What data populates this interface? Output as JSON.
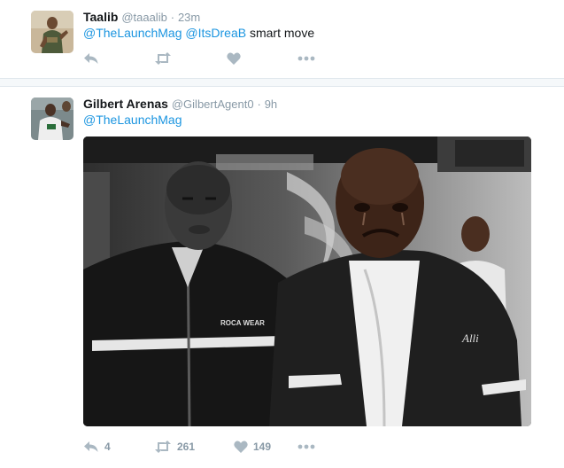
{
  "tweets": [
    {
      "name": "Taalib",
      "handle": "@taaalib",
      "separator": "·",
      "time": "23m",
      "mentions": [
        "@TheLaunchMag",
        "@ItsDreaB"
      ],
      "text_tail": "smart move",
      "counts": {
        "reply": "",
        "retweet": "",
        "like": ""
      }
    },
    {
      "name": "Gilbert Arenas",
      "handle": "@GilbertAgent0",
      "separator": "·",
      "time": "9h",
      "mentions": [
        "@TheLaunchMag"
      ],
      "media_texts": {
        "logo_left": "ROCA WEAR",
        "logo_right": "Alli"
      },
      "counts": {
        "reply": "4",
        "retweet": "261",
        "like": "149"
      }
    }
  ],
  "icons": {
    "reply": "reply-icon",
    "retweet": "retweet-icon",
    "like": "heart-icon",
    "more": "more-dots-icon"
  },
  "colors": {
    "link": "#1b95e0",
    "action_icon": "#aab8c2",
    "meta_text": "#8899a6",
    "divider": "#e1e8ed",
    "gap_bg": "#f5f8fa"
  }
}
